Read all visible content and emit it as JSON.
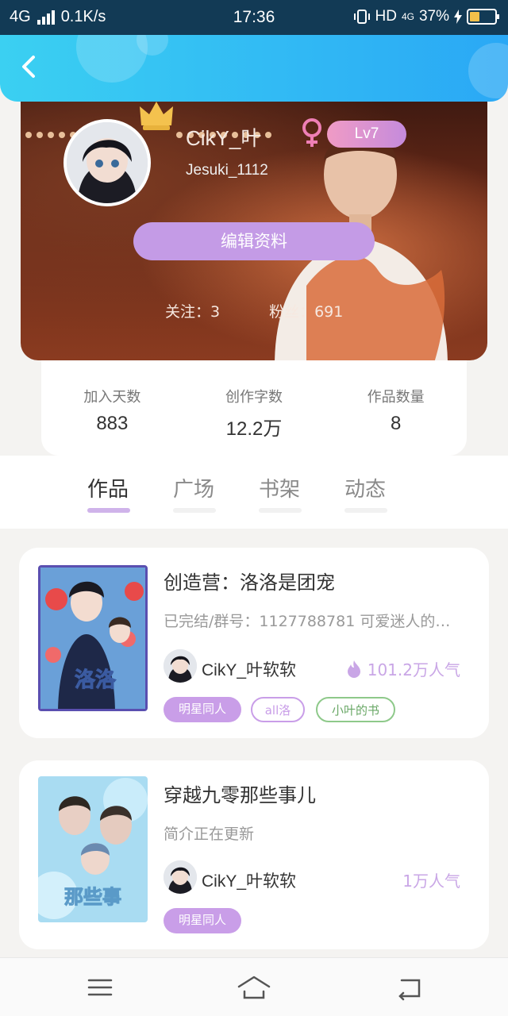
{
  "status_bar": {
    "network": "4G",
    "speed": "0.1K/s",
    "time": "17:36",
    "hd": "HD",
    "network2": "4G",
    "battery": "37%"
  },
  "profile": {
    "username": "CikY_叶",
    "level": "Lv7",
    "user_id": "Jesuki_1112",
    "edit_button": "编辑资料",
    "follow_label": "关注：3",
    "fans_label": "粉丝：691"
  },
  "stats": [
    {
      "label": "加入天数",
      "value": "883"
    },
    {
      "label": "创作字数",
      "value": "12.2万"
    },
    {
      "label": "作品数量",
      "value": "8"
    }
  ],
  "tabs": [
    "作品",
    "广场",
    "书架",
    "动态"
  ],
  "books": [
    {
      "title": "创造营：洛洛是团宠",
      "desc": "已完结/群号：1127788781 可爱迷人的…",
      "author": "CikY_叶软软",
      "heat": "101.2万人气",
      "tags": [
        "明星同人",
        "all洛",
        "小叶的书"
      ]
    },
    {
      "title": "穿越九零那些事儿",
      "desc": "简介正在更新",
      "author": "CikY_叶软软",
      "heat": "1万人气",
      "tags": [
        "明星同人"
      ]
    }
  ],
  "icons": {
    "back": "chevron-left-icon",
    "crown": "crown-icon",
    "gender": "female-icon",
    "heat": "flame-icon",
    "nav": [
      "menu-icon",
      "home-icon",
      "back-icon"
    ]
  },
  "colors": {
    "header": "#2aa8f5",
    "accent": "#c49be6",
    "tag_green": "#8ec98a"
  }
}
